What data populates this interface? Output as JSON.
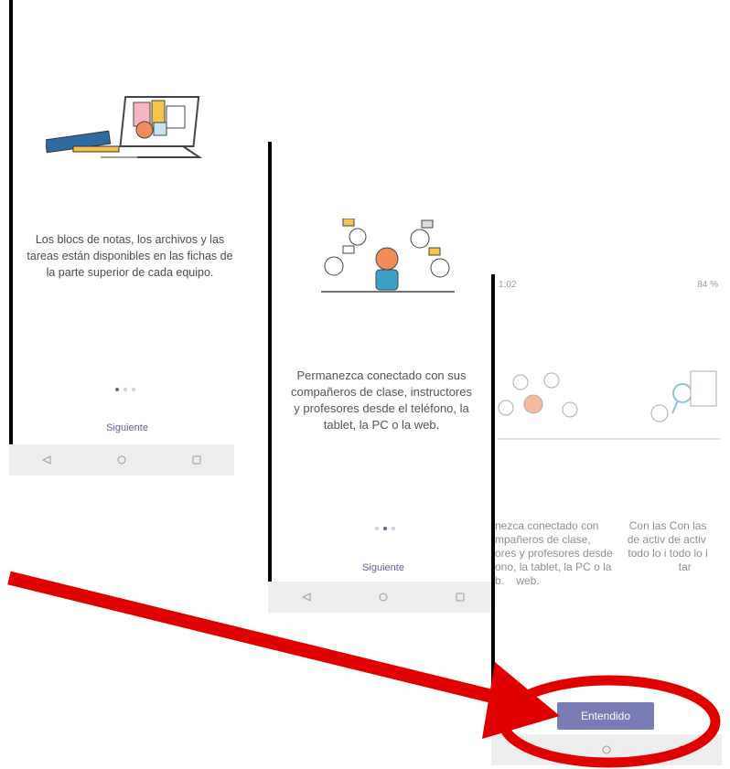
{
  "screens": [
    {
      "body": "Los blocs de notas, los archivos y las tareas están disponibles en las fichas de la parte superior de cada equipo.",
      "button": "Siguiente",
      "dots_active": 1
    },
    {
      "body": "Permanezca conectado con sus compañeros de clase, instructores y profesores desde el teléfono, la tablet, la PC o la web.",
      "button": "Siguiente",
      "dots_active": 2
    },
    {
      "status_time": "1:02",
      "status_battery": "84 %",
      "ghost_lines": [
        "nezca conectado con          Con las Con las",
        "mpañeros de clase,            de activ de activ",
        "ores y profesores desde     todo lo i todo lo i",
        "ono, la tablet, la PC o la                      tar",
        "b.    web."
      ],
      "button": "Entendido"
    }
  ],
  "annotation": {
    "arrow_color": "#e00000",
    "circle_color": "#e00000"
  },
  "colors": {
    "accent": "#6264a7",
    "button": "#7a7db5",
    "navbar": "#ededed"
  }
}
